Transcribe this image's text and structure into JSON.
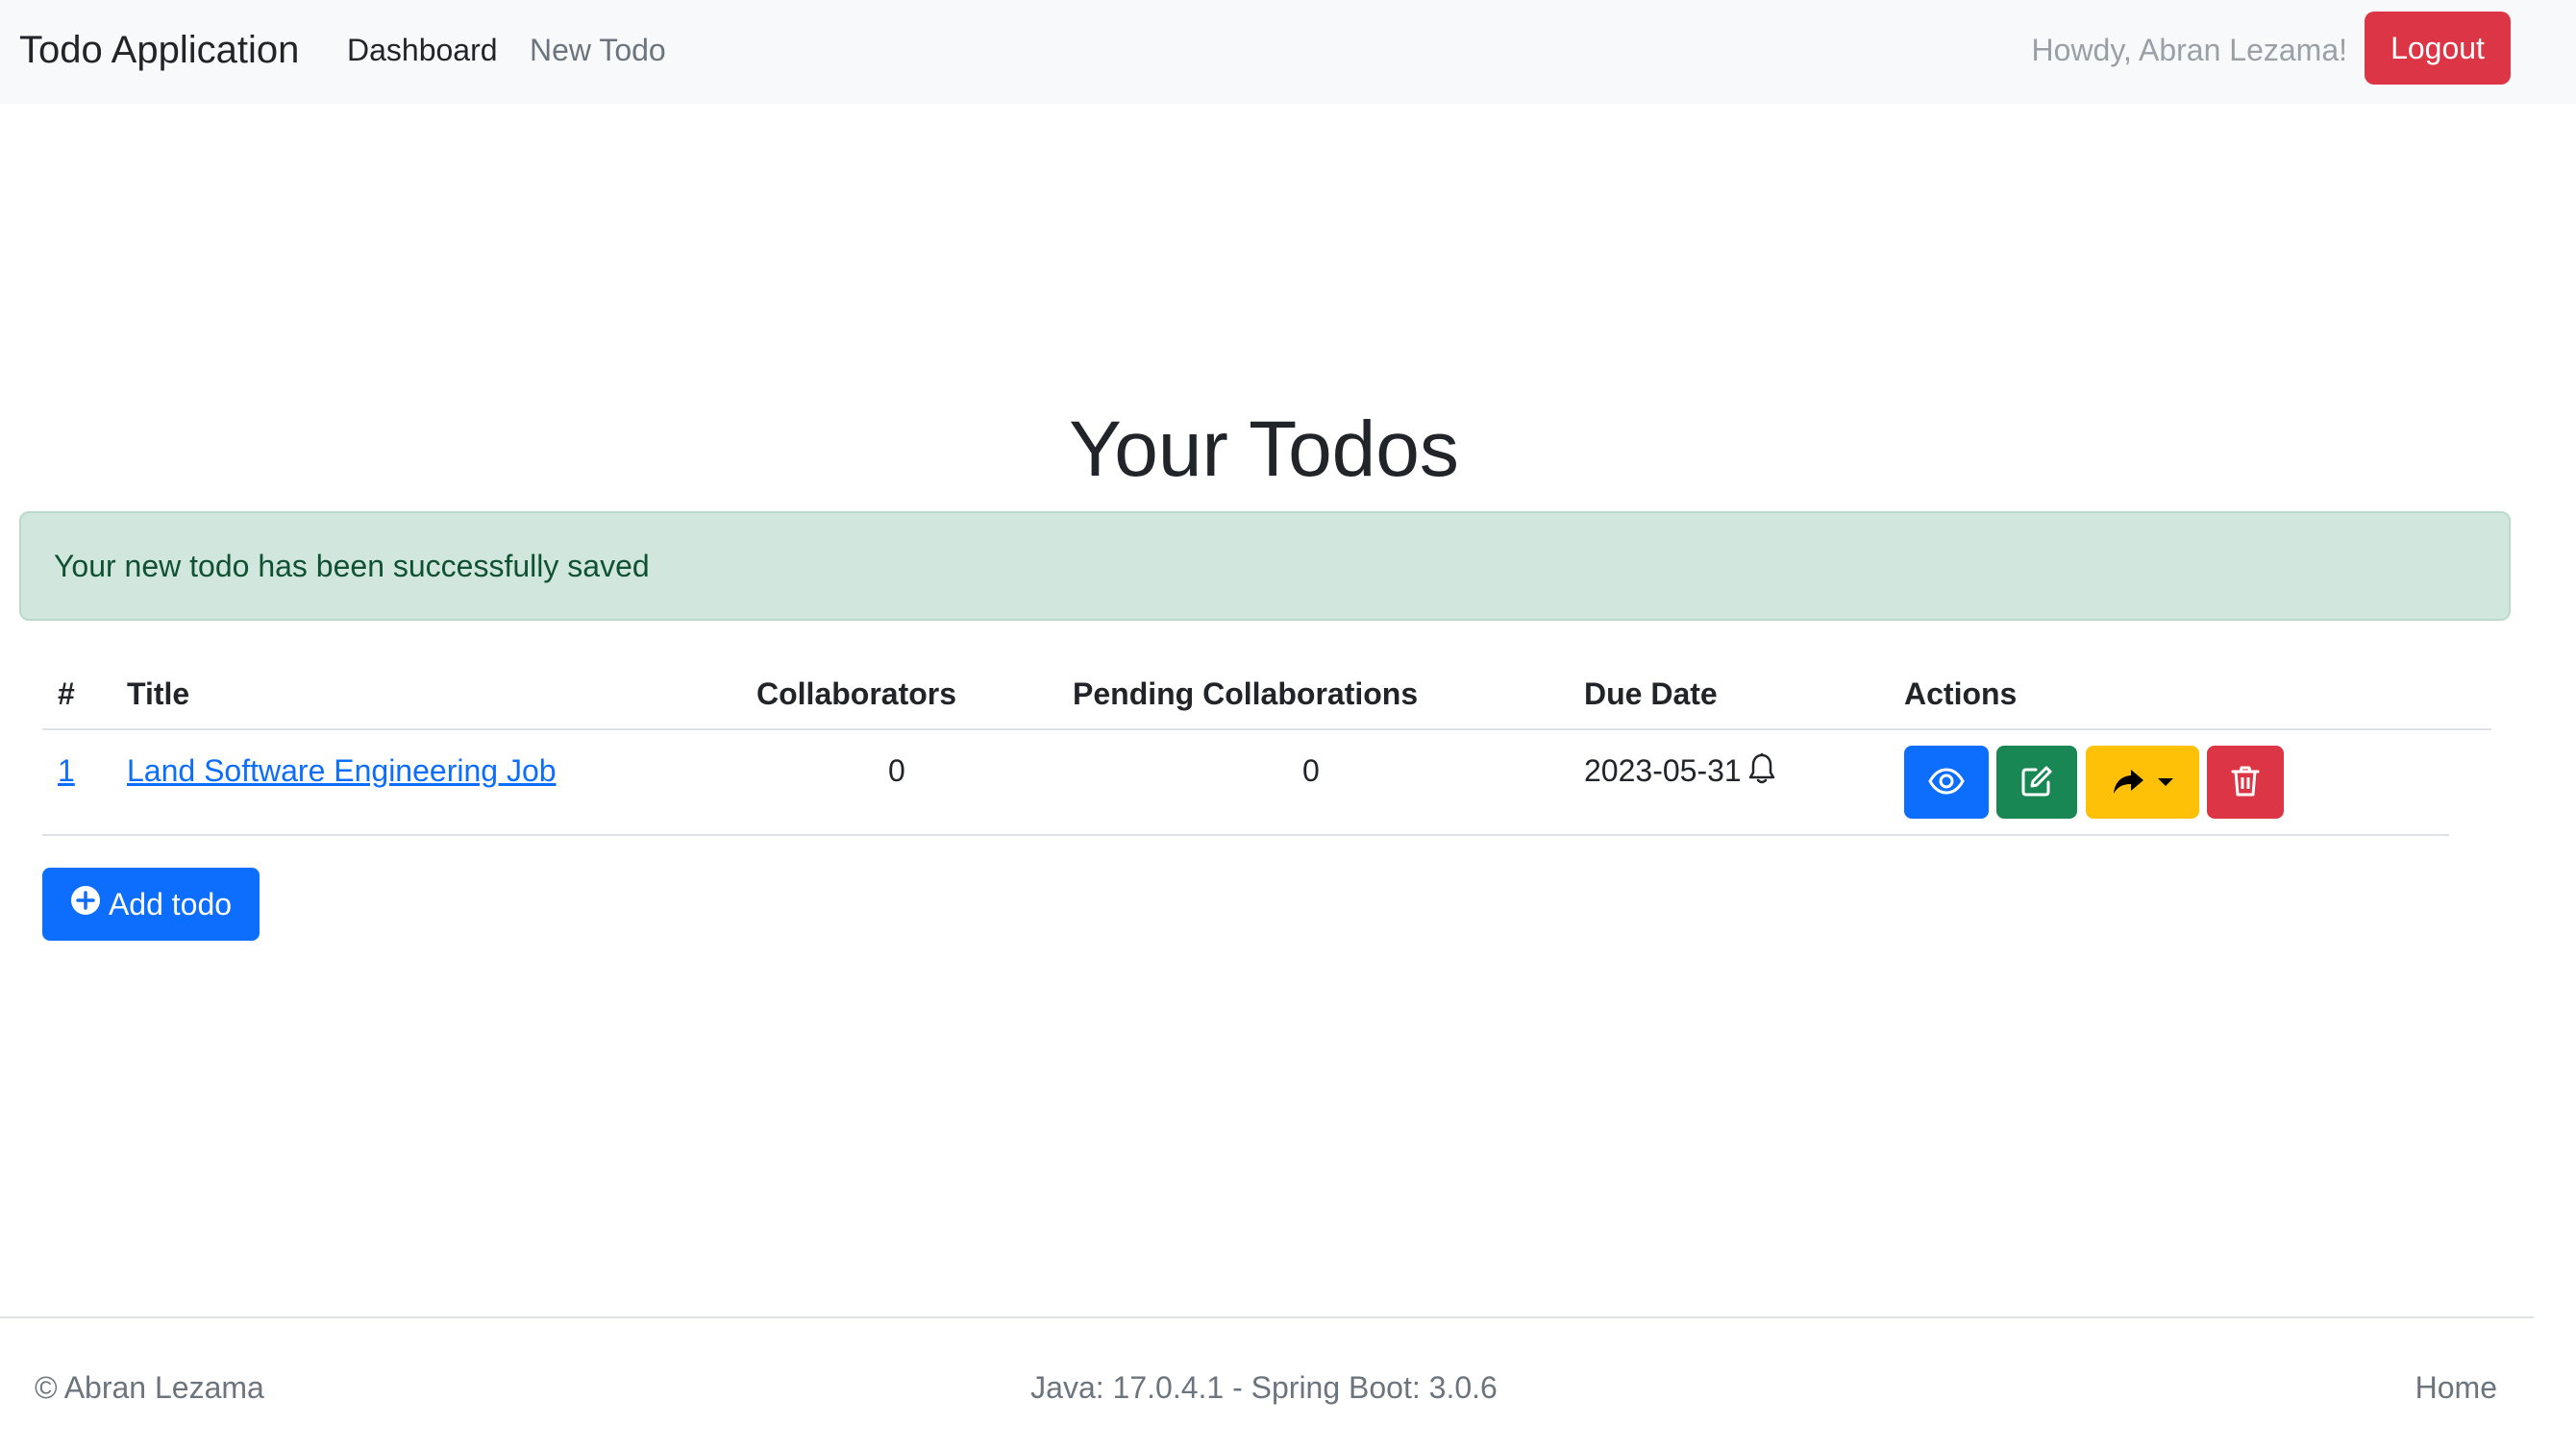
{
  "navbar": {
    "brand": "Todo Application",
    "links": [
      {
        "label": "Dashboard",
        "active": true
      },
      {
        "label": "New Todo",
        "active": false
      }
    ],
    "greeting": "Howdy, Abran Lezama!",
    "logout_label": "Logout"
  },
  "main": {
    "title": "Your Todos",
    "alert": "Your new todo has been successfully saved",
    "table": {
      "columns": [
        "#",
        "Title",
        "Collaborators",
        "Pending Collaborations",
        "Due Date",
        "Actions"
      ],
      "rows": [
        {
          "id": "1",
          "title": "Land Software Engineering Job",
          "collaborators": "0",
          "pending": "0",
          "due_date": "2023-05-31",
          "actions": [
            "view-icon",
            "edit-icon",
            "share-icon",
            "delete-icon"
          ]
        }
      ]
    },
    "add_button_label": "Add todo"
  },
  "footer": {
    "copyright": "© Abran Lezama",
    "versions": "Java: 17.0.4.1 - Spring Boot: 3.0.6",
    "home_label": "Home"
  },
  "colors": {
    "primary": "#0d6efd",
    "success": "#198754",
    "warning": "#ffc107",
    "danger": "#dc3545",
    "alert_bg": "#d1e7dd",
    "alert_text": "#0f5132",
    "navbar_bg": "#f8f9fa"
  }
}
